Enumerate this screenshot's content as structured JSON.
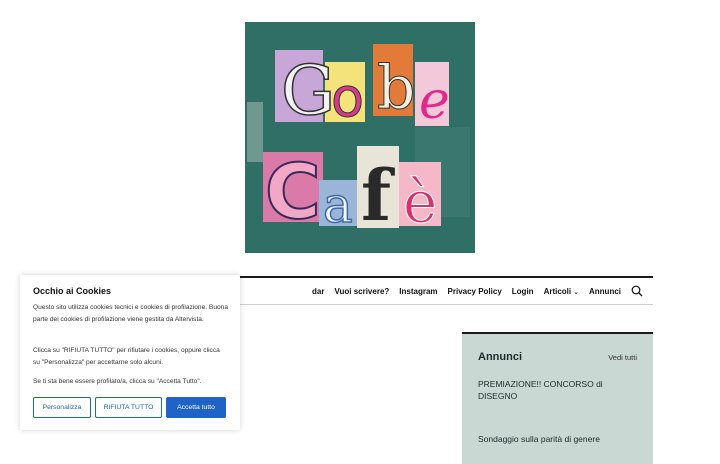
{
  "logo": {
    "alt_text": "Gobe Cafè",
    "letters_top": [
      "G",
      "o",
      "b",
      "e"
    ],
    "letters_bottom": [
      "C",
      "a",
      "f",
      "è"
    ],
    "background_color": "#2f6f66"
  },
  "nav": {
    "items": [
      {
        "label": "dar",
        "dropdown": false
      },
      {
        "label": "Vuoi scrivere?",
        "dropdown": false
      },
      {
        "label": "Instagram",
        "dropdown": false
      },
      {
        "label": "Privacy Policy",
        "dropdown": false
      },
      {
        "label": "Login",
        "dropdown": false
      },
      {
        "label": "Articoli",
        "dropdown": true
      },
      {
        "label": "Annunci",
        "dropdown": false
      }
    ],
    "search_icon": "search-icon"
  },
  "sidebar": {
    "title": "Annunci",
    "view_all": "Vedi tutti",
    "posts": [
      "PREMIAZIONE!! CONCORSO di DISEGNO",
      "Sondaggio sulla parità di genere"
    ],
    "background_color": "#c9d8d3"
  },
  "cookie": {
    "title": "Occhio ai Cookies",
    "paragraph1": "Questo sito utilizza cookies tecnici e cookies di profilazione. Buona parte dei cookies di profilazione viene gestita da Altervista.",
    "paragraph2": "Clicca su \"RIFIUTA TUTTO\" per rifiutare i cookies, oppure clicca su \"Personalizza\" per accettarne solo alcuni.",
    "paragraph3": "Se ti sta bene essere profilato/a, clicca su \"Accetta Tutto\".",
    "btn_customize": "Personalizza",
    "btn_reject": "RIFIUTA TUTTO",
    "btn_accept": "Accetta tutto",
    "accent_color": "#1e63c5"
  }
}
